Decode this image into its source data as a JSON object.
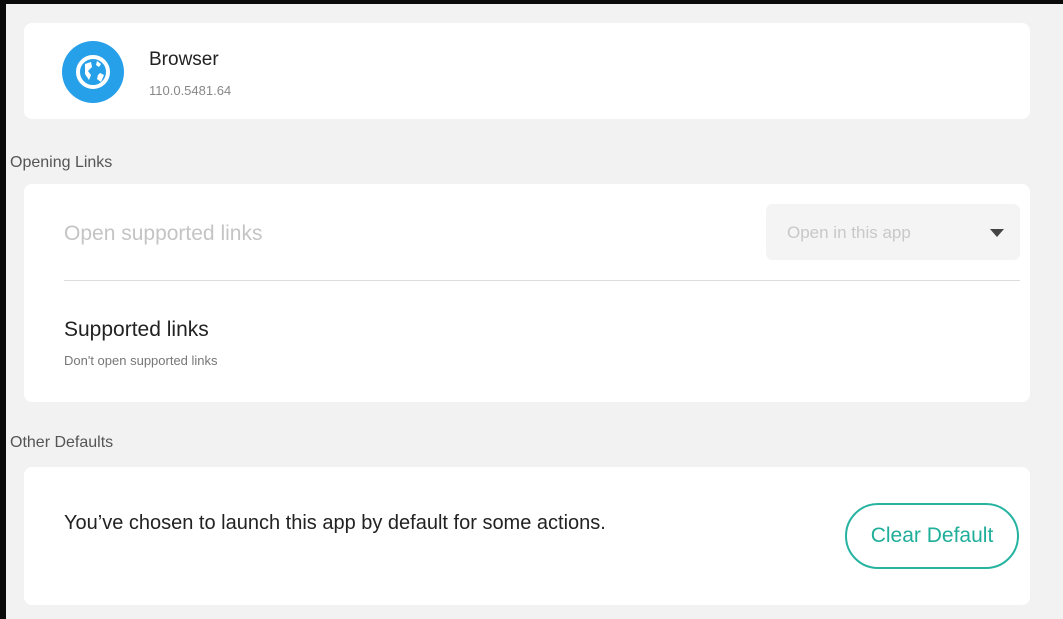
{
  "app": {
    "name": "Browser",
    "version": "110.0.5481.64",
    "icon": "globe-icon",
    "icon_color": "#27a0ea"
  },
  "opening_links": {
    "header": "Opening Links",
    "open_supported_label": "Open supported links",
    "dropdown": {
      "selected": "Open in this app",
      "icon": "triangle-down-icon"
    },
    "supported_links": {
      "title": "Supported links",
      "subtitle": "Don't open supported links"
    }
  },
  "other_defaults": {
    "header": "Other Defaults",
    "text": "You’ve chosen to launch this app by default for some actions.",
    "clear_button_label": "Clear Default",
    "accent_color": "#26b4a0"
  }
}
